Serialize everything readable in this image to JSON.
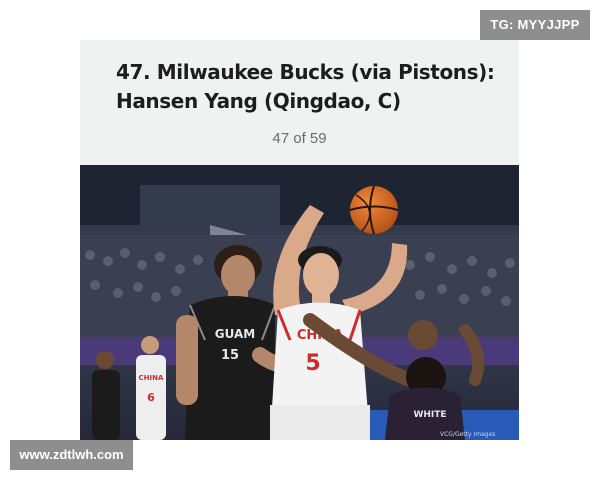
{
  "header": {
    "headline": "47. Milwaukee Bucks (via Pistons): Hansen Yang (Qingdao, C)",
    "counter": "47 of 59"
  },
  "photo": {
    "jersey_left": "GUAM",
    "jersey_left_number": "15",
    "jersey_center": "CHINA",
    "jersey_center_number": "5",
    "jersey_right": "WHITE",
    "bench_jersey": "CHINA",
    "bench_number": "6",
    "credit": "VCG/Getty Images"
  },
  "watermarks": {
    "top": "TG: MYYJJPP",
    "bottom": "www.zdtlwh.com"
  },
  "colors": {
    "header_bg": "#f0f1f1",
    "watermark_bg": "#8e8e8e",
    "china_red": "#d12a2a",
    "guam_black": "#1b1b1b"
  }
}
